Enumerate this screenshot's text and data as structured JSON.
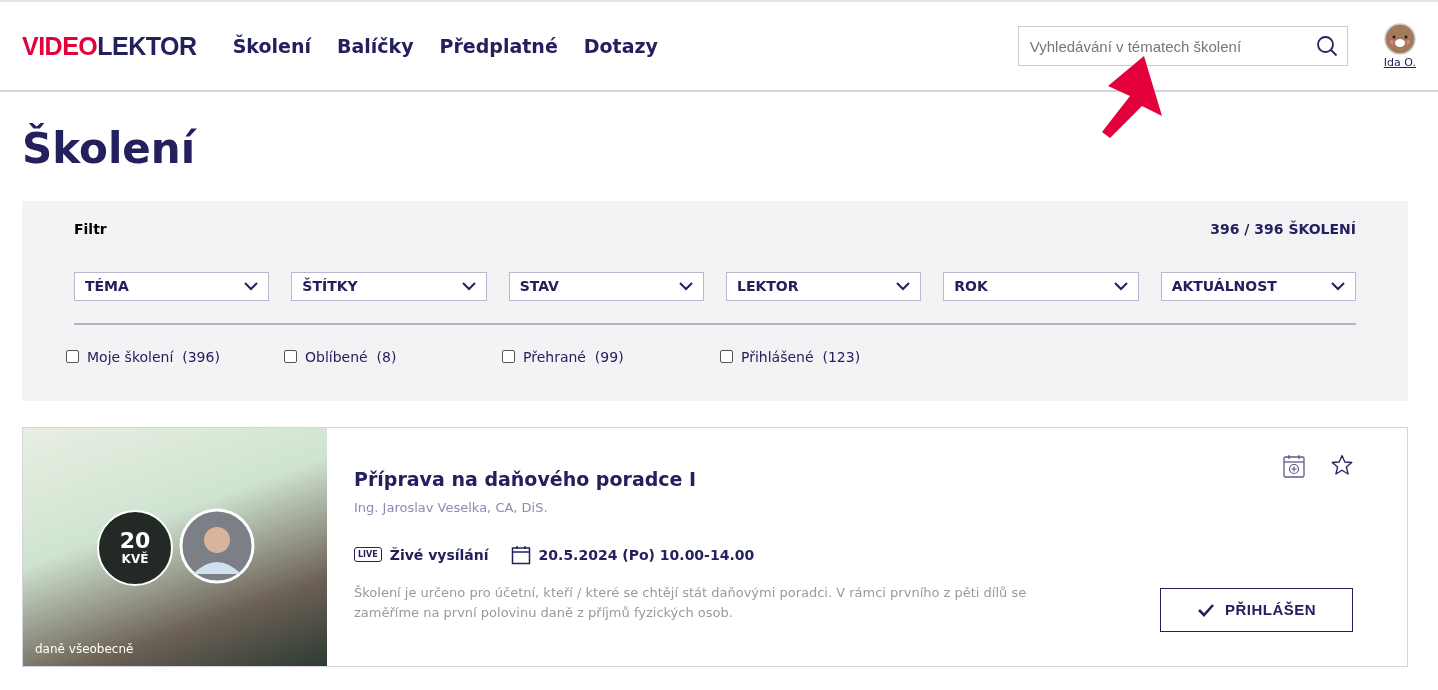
{
  "header": {
    "logo": {
      "part_1": "VIDEO",
      "part_2": "LEKTOR"
    },
    "nav": [
      "Školení",
      "Balíčky",
      "Předplatné",
      "Dotazy"
    ],
    "search": {
      "placeholder": "Vyhledávání v tématech školení"
    },
    "user": {
      "name": "Ida O."
    }
  },
  "page_title": "Školení",
  "filter": {
    "label": "Filtr",
    "count": "396 / 396 ŠKOLENÍ",
    "dropdowns": [
      "TÉMA",
      "ŠTÍTKY",
      "STAV",
      "LEKTOR",
      "ROK",
      "AKTUÁLNOST"
    ],
    "checkboxes": [
      {
        "label": "Moje školení",
        "count": "(396)",
        "checked": false
      },
      {
        "label": "Oblíbené",
        "count": "(8)",
        "checked": false
      },
      {
        "label": "Přehrané",
        "count": "(99)",
        "checked": false
      },
      {
        "label": "Přihlášené",
        "count": "(123)",
        "checked": false
      }
    ]
  },
  "courses": [
    {
      "day": "20",
      "month": "KVĚ",
      "tag": "daně všeobecně",
      "title": "Příprava na daňového poradce I",
      "lecturer": "Ing. Jaroslav Veselka, CA, DiS.",
      "live_badge": "LIVE",
      "mode": "Živé vysílání",
      "date": "20.5.2024 (Po) 10.00-14.00",
      "description": "Školení je určeno pro účetní, kteří / které se chtějí stát daňovými poradci. V rámci prvního z pěti dílů se zaměříme na první polovinu daně z příjmů fyzických osob.",
      "favorite": false,
      "button": "PŘIHLÁŠEN"
    }
  ]
}
